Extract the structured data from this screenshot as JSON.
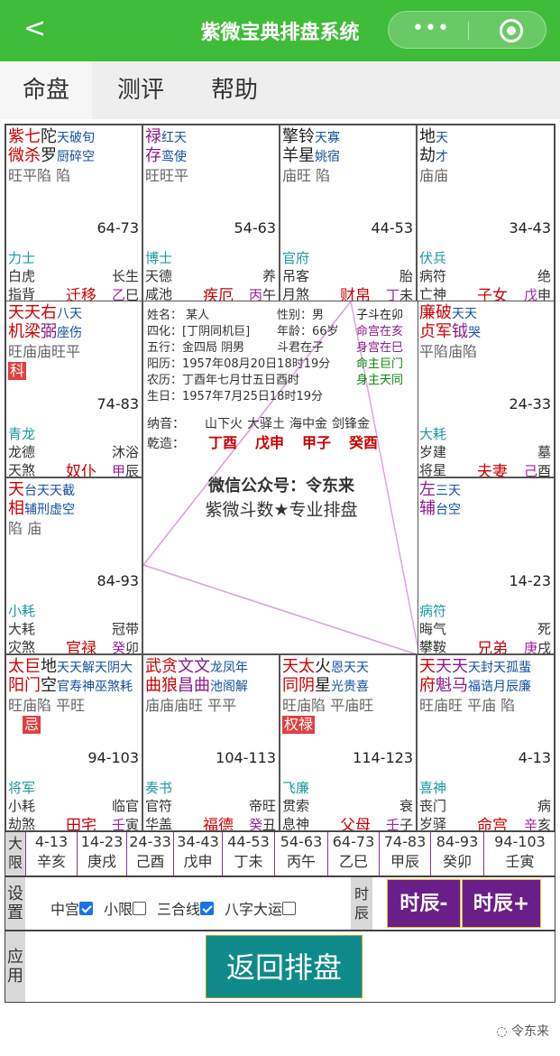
{
  "topbar": {
    "back": "<",
    "title": "紫微宝典排盘系统",
    "dots": "•••"
  },
  "tabs": [
    "命盘",
    "测评",
    "帮助"
  ],
  "cells": [
    {
      "id": "si",
      "row": 0,
      "col": 0,
      "l1": [
        [
          "紫",
          "red"
        ],
        [
          "七",
          "red"
        ],
        [
          "陀",
          "blk"
        ],
        [
          "天破旬",
          "blu sm"
        ]
      ],
      "l2": [
        [
          "微",
          "red"
        ],
        [
          "杀",
          "red"
        ],
        [
          "罗",
          "blk"
        ],
        [
          "厨碎空",
          "blu sm"
        ]
      ],
      "l3": "旺平陷    陷",
      "rng": "64-73",
      "gd1": "力士",
      "gd2": "白虎",
      "gd3": "指背",
      "ls": "长生",
      "pal": "迁移",
      "pgz": [
        "乙",
        "巳"
      ]
    },
    {
      "id": "wu",
      "row": 0,
      "col": 1,
      "l1": [
        [
          "禄",
          "pur"
        ],
        [
          "红天",
          "blu sm"
        ]
      ],
      "l2": [
        [
          "存",
          "pur"
        ],
        [
          "鸾使",
          "blu sm"
        ]
      ],
      "l3": "旺旺平",
      "rng": "54-63",
      "gd1": "博士",
      "gd2": "天德",
      "gd3": "咸池",
      "ls": "养",
      "pal": "疾厄",
      "pgz": [
        "丙",
        "午"
      ]
    },
    {
      "id": "wei",
      "row": 0,
      "col": 2,
      "l1": [
        [
          "擎铃",
          "blk"
        ],
        [
          "天寡",
          "blu sm"
        ]
      ],
      "l2": [
        [
          "羊星",
          "blk"
        ],
        [
          "姚宿",
          "blu sm"
        ]
      ],
      "l3": "庙旺   陷",
      "rng": "44-53",
      "gd1": "官府",
      "gd2": "吊客",
      "gd3": "月煞",
      "ls": "胎",
      "pal": "财帛",
      "pgz": [
        "丁",
        "未"
      ]
    },
    {
      "id": "shen",
      "row": 0,
      "col": 3,
      "l1": [
        [
          "地",
          "blk"
        ],
        [
          "天",
          "blu sm"
        ]
      ],
      "l2": [
        [
          "劫",
          "blk"
        ],
        [
          "才",
          "blu sm"
        ]
      ],
      "l3": "庙庙",
      "rng": "34-43",
      "gd1": "伏兵",
      "gd2": "病符",
      "gd3": "亡神",
      "ls": "绝",
      "pal": "子女",
      "pgz": [
        "戊",
        "申"
      ]
    },
    {
      "id": "chen",
      "row": 1,
      "col": 0,
      "l1": [
        [
          "天",
          "red"
        ],
        [
          "天",
          "red"
        ],
        [
          "右",
          "red"
        ],
        [
          "八天",
          "blu sm"
        ]
      ],
      "l2": [
        [
          "机",
          "red"
        ],
        [
          "梁",
          "red"
        ],
        [
          "弼",
          "pur"
        ],
        [
          "座伤",
          "blu sm"
        ]
      ],
      "l3": "旺庙庙旺平",
      "tag": "科",
      "rng": "74-83",
      "gd1": "青龙",
      "gd2": "龙德",
      "gd3": "天煞",
      "ls": "沐浴",
      "pal": "奴仆",
      "pgz": [
        "甲",
        "辰"
      ]
    },
    {
      "id": "you",
      "row": 1,
      "col": 3,
      "l1": [
        [
          "廉",
          "red"
        ],
        [
          "破",
          "red"
        ],
        [
          "天天",
          "blu sm"
        ]
      ],
      "l2": [
        [
          "贞",
          "red"
        ],
        [
          "军",
          "red"
        ],
        [
          "钺",
          "pur"
        ],
        [
          "哭",
          "blu sm"
        ]
      ],
      "l3": "平陷庙陷",
      "rng": "24-33",
      "gd1": "大耗",
      "gd2": "岁建",
      "gd3": "将星",
      "ls": "墓",
      "pal": "夫妻",
      "pgz": [
        "己",
        "酉"
      ]
    },
    {
      "id": "mao",
      "row": 2,
      "col": 0,
      "l1": [
        [
          "天",
          "red"
        ],
        [
          "台天天截",
          "blu sm"
        ]
      ],
      "l2": [
        [
          "相",
          "red"
        ],
        [
          "辅刑虚空",
          "blu sm"
        ]
      ],
      "l3": "陷    庙",
      "rng": "84-93",
      "gd1": "小耗",
      "gd2": "大耗",
      "gd3": "灾煞",
      "ls": "冠带",
      "pal": "官禄",
      "pgz": [
        "癸",
        "卯"
      ]
    },
    {
      "id": "xu",
      "row": 2,
      "col": 3,
      "l1": [
        [
          "左",
          "pur"
        ],
        [
          "三天",
          "blu sm"
        ]
      ],
      "l2": [
        [
          "辅",
          "pur"
        ],
        [
          "台空",
          "blu sm"
        ]
      ],
      "l3": "",
      "rng": "14-23",
      "gd1": "病符",
      "gd2": "晦气",
      "gd3": "攀鞍",
      "ls": "死",
      "pal": "兄弟",
      "pgz": [
        "庚",
        "戌"
      ]
    },
    {
      "id": "yin",
      "row": 3,
      "col": 0,
      "l1": [
        [
          "太",
          "red"
        ],
        [
          "巨",
          "red"
        ],
        [
          "地",
          "blk"
        ],
        [
          "天天解天阴大",
          "blu sm"
        ]
      ],
      "l2": [
        [
          "阳",
          "red"
        ],
        [
          "门",
          "red"
        ],
        [
          "空",
          "blk"
        ],
        [
          "官寿神巫煞耗",
          "blu sm"
        ]
      ],
      "l3": "旺庙陷 平旺",
      "tag": "忌",
      "rng": "94-103",
      "gd1": "将军",
      "gd2": "小耗",
      "gd3": "劫煞",
      "ls": "临官",
      "pal": "田宅",
      "pgz": [
        "壬",
        "寅"
      ]
    },
    {
      "id": "chou",
      "row": 3,
      "col": 1,
      "l1": [
        [
          "武",
          "red"
        ],
        [
          "贪",
          "red"
        ],
        [
          "文",
          "pur"
        ],
        [
          "文",
          "pur"
        ],
        [
          "龙凤年",
          "blu sm"
        ]
      ],
      "l2": [
        [
          "曲",
          "red"
        ],
        [
          "狼",
          "red"
        ],
        [
          "昌",
          "pur"
        ],
        [
          "曲",
          "pur"
        ],
        [
          "池阁解",
          "blu sm"
        ]
      ],
      "l3": "庙庙庙旺 平平",
      "rng": "104-113",
      "gd1": "奏书",
      "gd2": "官符",
      "gd3": "华盖",
      "ls": "帝旺",
      "pal": "福德",
      "pgz": [
        "癸",
        "丑"
      ]
    },
    {
      "id": "zi",
      "row": 3,
      "col": 2,
      "l1": [
        [
          "天",
          "red"
        ],
        [
          "太",
          "red"
        ],
        [
          "火",
          "blk"
        ],
        [
          "恩天天",
          "blu sm"
        ]
      ],
      "l2": [
        [
          "同",
          "red"
        ],
        [
          "阴",
          "red"
        ],
        [
          "星",
          "blk"
        ],
        [
          "光贵喜",
          "blu sm"
        ]
      ],
      "l3": "旺庙陷 平庙旺",
      "tag": "权禄",
      "rng": "114-123",
      "gd1": "飞廉",
      "gd2": "贯索",
      "gd3": "息神",
      "ls": "衰",
      "pal": "父母",
      "pgz": [
        "壬",
        "子"
      ]
    },
    {
      "id": "hai",
      "row": 3,
      "col": 3,
      "l1": [
        [
          "天",
          "red"
        ],
        [
          "天",
          "pur"
        ],
        [
          "天",
          "pur"
        ],
        [
          "天封天孤蜚",
          "blu sm"
        ]
      ],
      "l2": [
        [
          "府",
          "red"
        ],
        [
          "魁",
          "pur"
        ],
        [
          "马",
          "pur"
        ],
        [
          "福诰月辰廉",
          "blu sm"
        ]
      ],
      "l3": "旺庙旺 平庙     陷",
      "rng": "4-13",
      "gd1": "喜神",
      "gd2": "丧门",
      "gd3": "岁驿",
      "ls": "病",
      "pal": "命宫",
      "pgz": [
        "辛",
        "亥"
      ]
    }
  ],
  "center": {
    "rows": [
      {
        "a": "姓名：  某人",
        "b": "性别：男",
        "c": "子斗在卯",
        "cc": "blk"
      },
      {
        "a": "四化：[丁阴同机巨]",
        "b": "年龄：66岁",
        "c": "命宫在亥",
        "cc": "pur"
      },
      {
        "a": "五行：金四局 阴男",
        "b": "斗君在子",
        "c": "身宫在巳",
        "cc": "pur"
      },
      {
        "a": "阳历：1957年08月20日18时19分",
        "b": "",
        "c": "命主巨门",
        "cc": "grn"
      },
      {
        "a": "农历：丁酉年七月廿五日酉时",
        "b": "",
        "c": "身主天同",
        "cc": "grn"
      },
      {
        "a": "生日：1957年7月25日18时19分",
        "b": "",
        "c": "",
        "cc": "blk"
      }
    ],
    "nayin_label": "纳音：",
    "nayin": [
      "山下火",
      "大驿土",
      "海中金",
      "剑锋金"
    ],
    "bazi_label": "乾造：",
    "bazi": [
      "丁酉",
      "戊申",
      "甲子",
      "癸酉"
    ],
    "wechat": "微信公众号：令东来",
    "slogan": "紫微斗数★专业排盘"
  },
  "daxian": {
    "label": "大限",
    "items": [
      [
        "4-13",
        "辛亥"
      ],
      [
        "14-23",
        "庚戌"
      ],
      [
        "24-33",
        "己酉"
      ],
      [
        "34-43",
        "戊申"
      ],
      [
        "44-53",
        "丁未"
      ],
      [
        "54-63",
        "丙午"
      ],
      [
        "64-73",
        "乙巳"
      ],
      [
        "74-83",
        "甲辰"
      ],
      [
        "84-93",
        "癸卯"
      ],
      [
        "94-103",
        "壬寅"
      ]
    ]
  },
  "settings": {
    "label": "设置",
    "opts": [
      {
        "label": "中宫",
        "on": true
      },
      {
        "label": "小限",
        "on": false
      },
      {
        "label": "三合线",
        "on": true
      },
      {
        "label": "八字大运",
        "on": false
      }
    ],
    "time_label": "时辰",
    "prev": "时辰-",
    "next": "时辰+"
  },
  "apply": {
    "label": "应用",
    "button": "返回排盘"
  },
  "footer": "令东来",
  "colors": {
    "green": "#3fbc3a",
    "purple": "#6a1e8a",
    "teal": "#0f8a8a",
    "red": "#cc0000"
  }
}
